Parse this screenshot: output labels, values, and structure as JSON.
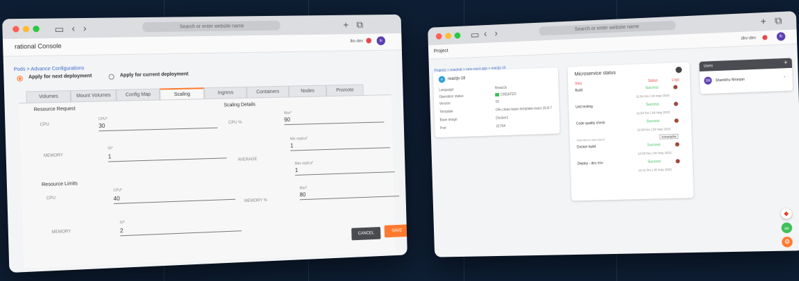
{
  "colors": {
    "background": "#0d1d33",
    "accent": "#ff7a2f",
    "success": "#3fbf5a",
    "error": "#e5484d",
    "avatar": "#5b3fb0"
  },
  "left_window": {
    "url_placeholder": "Search or enter website name",
    "app_title": "rational Console",
    "user": "lbs-dev",
    "avatar_initials": "lb",
    "breadcrumb": "Pods > Advance Configurations",
    "radio_options": [
      "Apply for next deployment",
      "Apply for current deployment"
    ],
    "tabs": [
      "Volumes",
      "Mount Volumes",
      "Config Map",
      "Scaling",
      "Ingress",
      "Containers",
      "Nodes",
      "Promote"
    ],
    "active_tab": "Scaling",
    "resource_request": {
      "title": "Resource Request",
      "cpu_label": "CPU",
      "cpu_field_label": "CPU*",
      "cpu_value": "30",
      "memory_label": "MEMORY",
      "memory_field_label": "GI*",
      "memory_value": "1"
    },
    "resource_limits": {
      "title": "Resource Limits",
      "cpu_label": "CPU",
      "cpu_field_label": "CPU*",
      "cpu_value": "40",
      "memory_label": "MEMORY",
      "memory_field_label": "GI*",
      "memory_value": "2"
    },
    "scaling_details": {
      "title": "Scaling Details",
      "cpu_label": "CPU %",
      "cpu_field_label": "Max*",
      "cpu_value": "90",
      "average_label": "AVERAGE",
      "min_replicas_label": "Min replica*",
      "min_replicas_value": "1",
      "max_replicas_label": "Max replica*",
      "max_replicas_value": "1",
      "memory_label": "MEMORY %",
      "memory_field_label": "Max*",
      "memory_value": "80"
    },
    "cancel_label": "CANCEL",
    "save_label": "SAVE"
  },
  "right_window": {
    "url_placeholder": "Search or enter website name",
    "app_title": "Project",
    "user": "dkv-dev",
    "avatar_initials": "lb",
    "breadcrumb": "Projects > reactnat > new-react-app > reactjs-16",
    "app_card": {
      "name": "reactjs-16",
      "rows": [
        {
          "key": "Language",
          "value": "ReactJs"
        },
        {
          "key": "Operation status",
          "value": "CREATED"
        },
        {
          "key": "Version",
          "value": "16"
        },
        {
          "key": "Template",
          "value": "Ofe-clean-base-template-react-16.8.7"
        },
        {
          "key": "Base image",
          "value": "Docker1"
        },
        {
          "key": "Port",
          "value": "31764"
        }
      ]
    },
    "status_card": {
      "title": "Microservice status",
      "headers": [
        "Step",
        "Status",
        "Logs"
      ],
      "steps": [
        {
          "name": "Build",
          "status": "Success",
          "time": "11:54 hrs | 20 may 2022"
        },
        {
          "name": "Unit testing",
          "status": "Success",
          "time": "11:54 hrs | 20 may 2022"
        },
        {
          "name": "Code quality check",
          "status": "Success",
          "time": "12:03 hrs | 20 may 2022"
        },
        {
          "name": "Docker build",
          "status": "Success",
          "time": "12:09 hrs | 20 may 2022"
        },
        {
          "name": "Deploy - dev env",
          "status": "Success",
          "time": "12:11 hrs | 20 may 2022"
        }
      ],
      "sonar_note": "Click link to view report",
      "sonar_label": "sonarqube"
    },
    "users_card": {
      "title": "Users",
      "add_icon": "plus-icon",
      "user_name": "Shambhu Niranjan",
      "user_initials": "SN"
    }
  }
}
